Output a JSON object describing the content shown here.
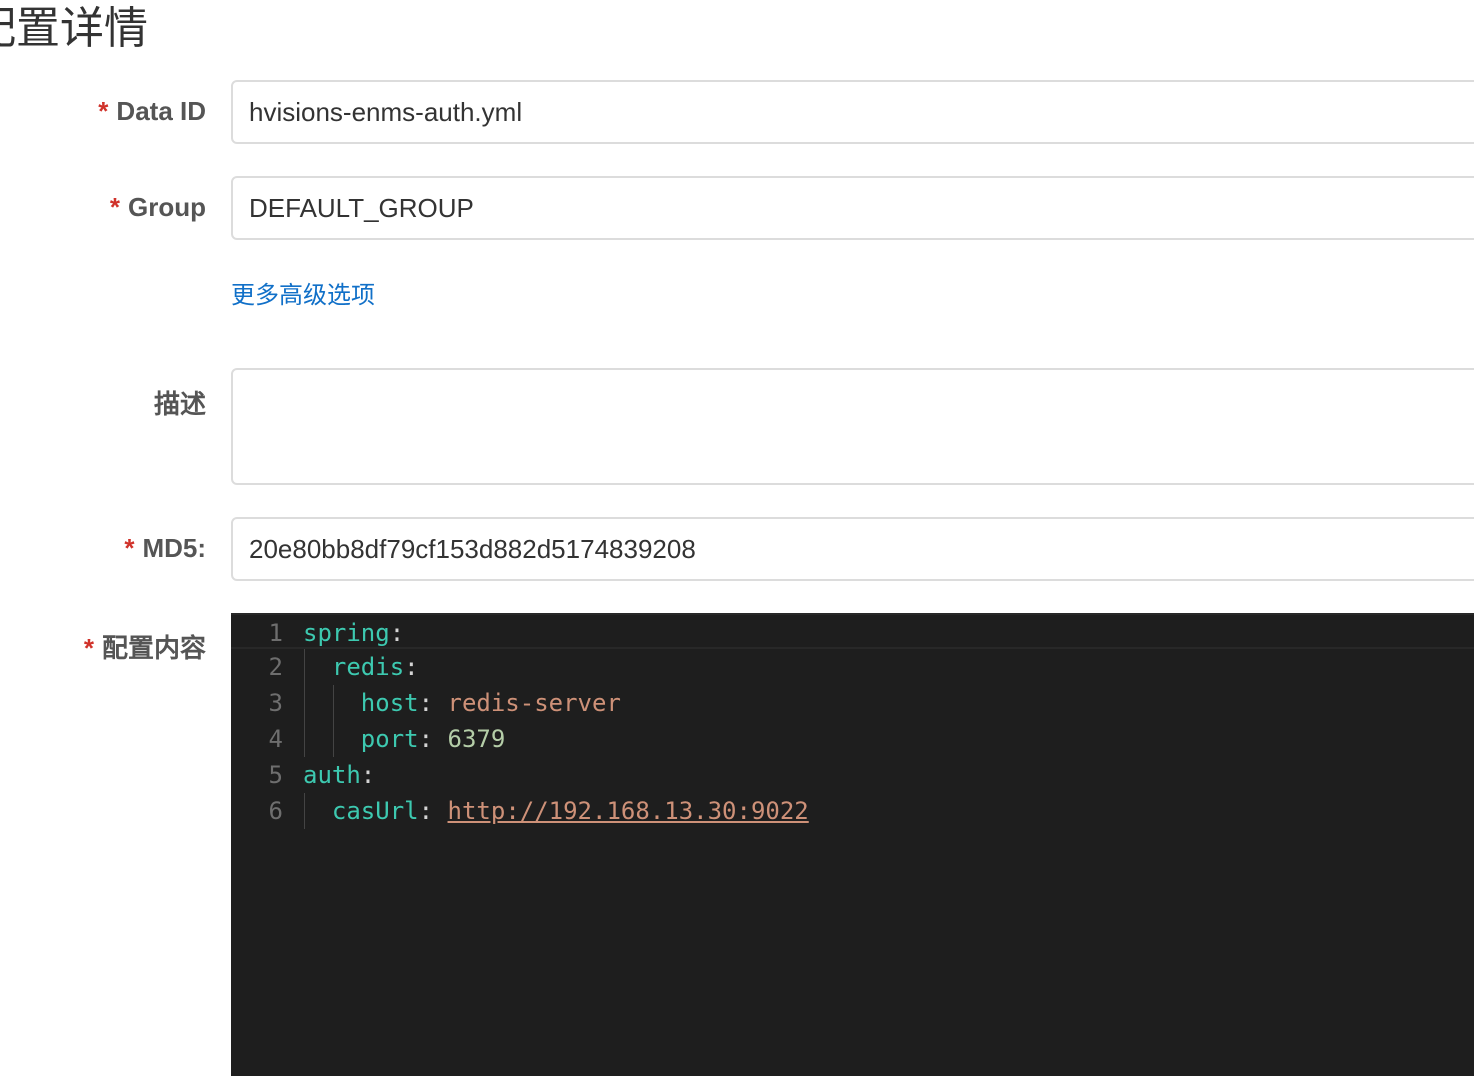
{
  "page": {
    "title": "配置详情"
  },
  "form": {
    "data_id": {
      "label": "Data ID",
      "value": "hvisions-enms-auth.yml"
    },
    "group": {
      "label": "Group",
      "value": "DEFAULT_GROUP"
    },
    "advanced_link": "更多高级选项",
    "description": {
      "label": "描述",
      "value": ""
    },
    "md5": {
      "label": "MD5:",
      "value": "20e80bb8df79cf153d882d5174839208"
    },
    "content": {
      "label": "配置内容"
    },
    "required_mark": "*"
  },
  "editor": {
    "lines": [
      {
        "num": "1",
        "key": "spring",
        "sep": ":",
        "value": "",
        "indent": "",
        "type": ""
      },
      {
        "num": "2",
        "key": "redis",
        "sep": ":",
        "value": "",
        "indent": "  ",
        "type": ""
      },
      {
        "num": "3",
        "key": "host",
        "sep": ": ",
        "value": "redis-server",
        "indent": "    ",
        "type": "s"
      },
      {
        "num": "4",
        "key": "port",
        "sep": ": ",
        "value": "6379",
        "indent": "    ",
        "type": "n"
      },
      {
        "num": "5",
        "key": "auth",
        "sep": ":",
        "value": "",
        "indent": "",
        "type": ""
      },
      {
        "num": "6",
        "key": "casUrl",
        "sep": ": ",
        "value": "http://192.168.13.30:9022",
        "indent": "  ",
        "type": "u"
      }
    ]
  }
}
